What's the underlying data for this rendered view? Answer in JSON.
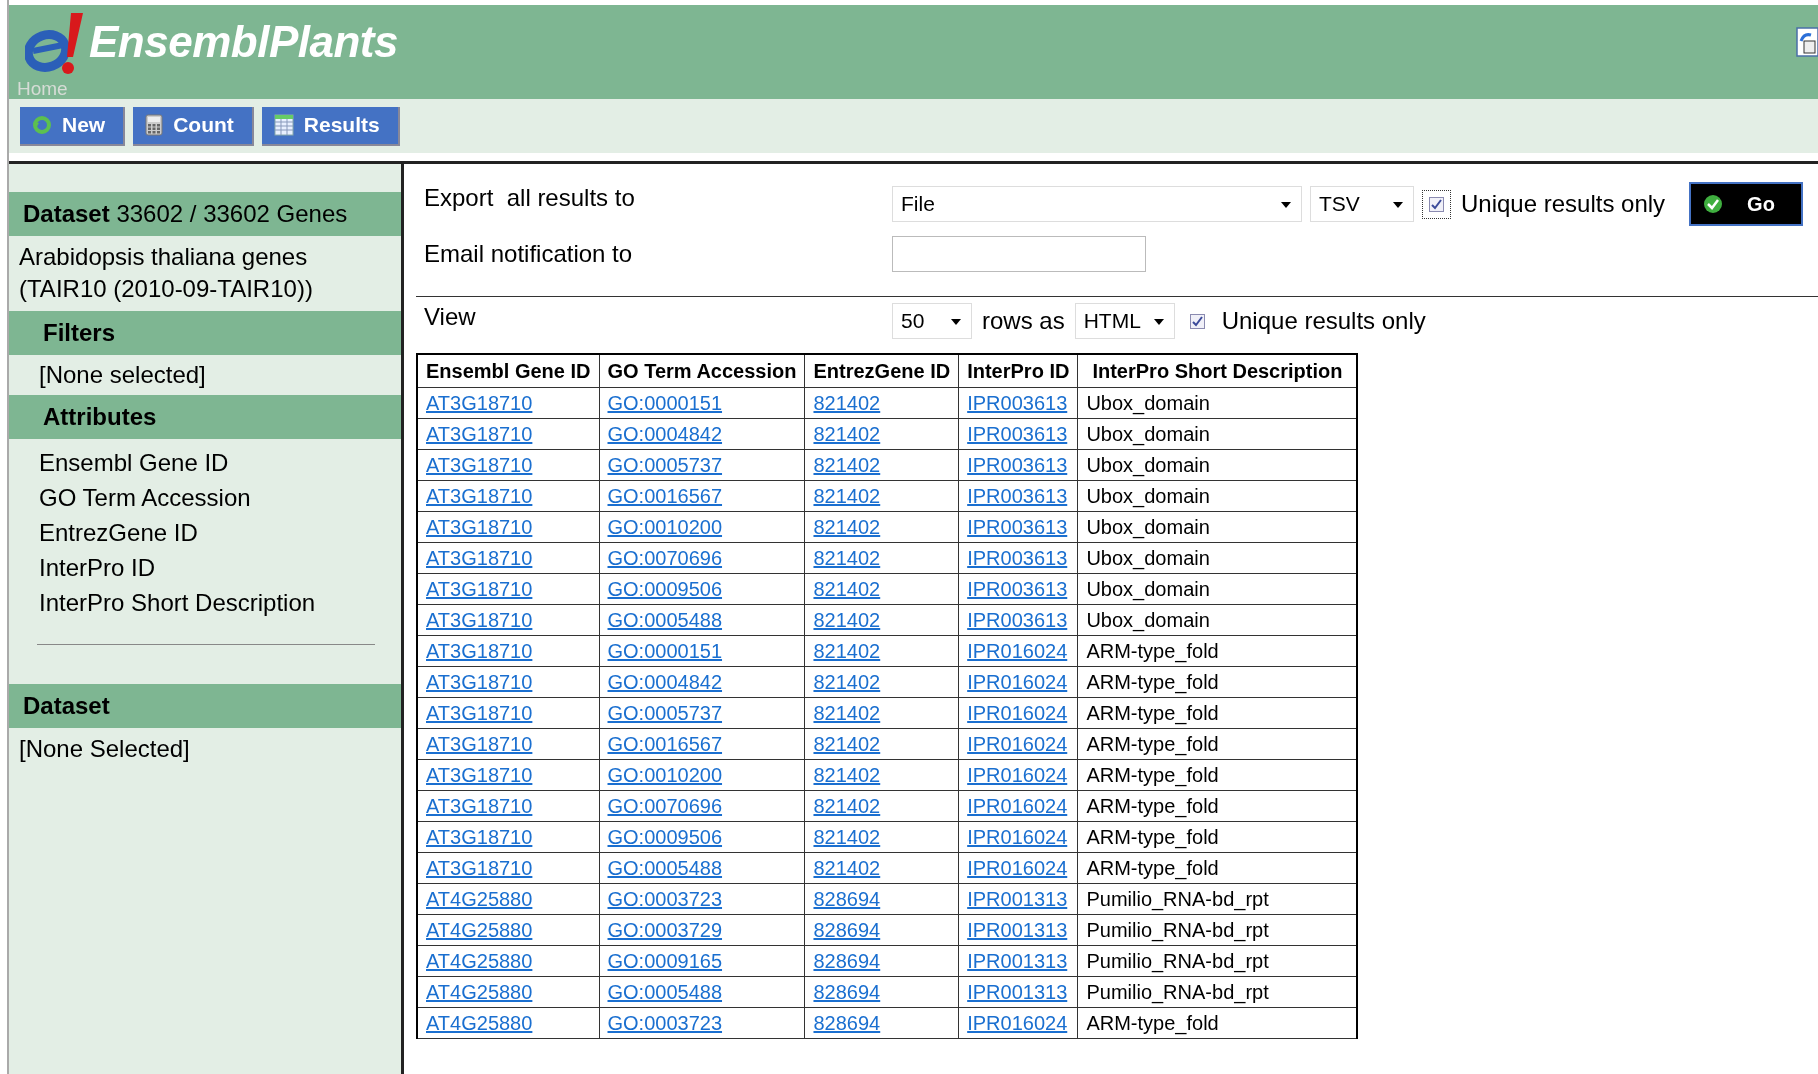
{
  "header": {
    "logo_text": "EnsemblPlants",
    "home_link": "Home"
  },
  "toolbar": [
    {
      "label": "New",
      "kind": "new"
    },
    {
      "label": "Count",
      "kind": "count"
    },
    {
      "label": "Results",
      "kind": "results"
    }
  ],
  "sidebar": {
    "dataset_summary": "**Dataset** 33602 / 33602 Genes",
    "dataset_name": "Arabidopsis thaliana genes (TAIR10 (2010-09-TAIR10))",
    "filters_heading": "Filters",
    "filters_value": "[None selected]",
    "attributes_heading": "Attributes",
    "attributes": [
      "Ensembl Gene ID",
      "GO Term Accession",
      "EntrezGene ID",
      "InterPro ID",
      "InterPro Short Description"
    ],
    "second_dataset_heading": "Dataset",
    "second_dataset_value": "[None Selected]"
  },
  "export": {
    "label": "Export  all results to",
    "destination": "File",
    "format": "TSV",
    "unique_checked": true,
    "unique_label": "Unique results only",
    "go_button": "Go"
  },
  "email": {
    "label": "Email notification to"
  },
  "view": {
    "label": "View",
    "rows": "50",
    "rows_label": "rows as",
    "format": "HTML",
    "unique_checked": true,
    "unique_label": "Unique results only"
  },
  "table": {
    "columns": [
      {
        "label": "Ensembl Gene ID",
        "kind": "link"
      },
      {
        "label": "GO Term Accession",
        "kind": "link"
      },
      {
        "label": "EntrezGene ID",
        "kind": "link"
      },
      {
        "label": "InterPro ID",
        "kind": "link"
      },
      {
        "label": "InterPro Short Description",
        "kind": "text"
      }
    ],
    "rows": [
      [
        "AT3G18710",
        "GO:0000151",
        "821402",
        "IPR003613",
        "Ubox_domain"
      ],
      [
        "AT3G18710",
        "GO:0004842",
        "821402",
        "IPR003613",
        "Ubox_domain"
      ],
      [
        "AT3G18710",
        "GO:0005737",
        "821402",
        "IPR003613",
        "Ubox_domain"
      ],
      [
        "AT3G18710",
        "GO:0016567",
        "821402",
        "IPR003613",
        "Ubox_domain"
      ],
      [
        "AT3G18710",
        "GO:0010200",
        "821402",
        "IPR003613",
        "Ubox_domain"
      ],
      [
        "AT3G18710",
        "GO:0070696",
        "821402",
        "IPR003613",
        "Ubox_domain"
      ],
      [
        "AT3G18710",
        "GO:0009506",
        "821402",
        "IPR003613",
        "Ubox_domain"
      ],
      [
        "AT3G18710",
        "GO:0005488",
        "821402",
        "IPR003613",
        "Ubox_domain"
      ],
      [
        "AT3G18710",
        "GO:0000151",
        "821402",
        "IPR016024",
        "ARM-type_fold"
      ],
      [
        "AT3G18710",
        "GO:0004842",
        "821402",
        "IPR016024",
        "ARM-type_fold"
      ],
      [
        "AT3G18710",
        "GO:0005737",
        "821402",
        "IPR016024",
        "ARM-type_fold"
      ],
      [
        "AT3G18710",
        "GO:0016567",
        "821402",
        "IPR016024",
        "ARM-type_fold"
      ],
      [
        "AT3G18710",
        "GO:0010200",
        "821402",
        "IPR016024",
        "ARM-type_fold"
      ],
      [
        "AT3G18710",
        "GO:0070696",
        "821402",
        "IPR016024",
        "ARM-type_fold"
      ],
      [
        "AT3G18710",
        "GO:0009506",
        "821402",
        "IPR016024",
        "ARM-type_fold"
      ],
      [
        "AT3G18710",
        "GO:0005488",
        "821402",
        "IPR016024",
        "ARM-type_fold"
      ],
      [
        "AT4G25880",
        "GO:0003723",
        "828694",
        "IPR001313",
        "Pumilio_RNA-bd_rpt"
      ],
      [
        "AT4G25880",
        "GO:0003729",
        "828694",
        "IPR001313",
        "Pumilio_RNA-bd_rpt"
      ],
      [
        "AT4G25880",
        "GO:0009165",
        "828694",
        "IPR001313",
        "Pumilio_RNA-bd_rpt"
      ],
      [
        "AT4G25880",
        "GO:0005488",
        "828694",
        "IPR001313",
        "Pumilio_RNA-bd_rpt"
      ],
      [
        "AT4G25880",
        "GO:0003723",
        "828694",
        "IPR016024",
        "ARM-type_fold"
      ]
    ]
  }
}
